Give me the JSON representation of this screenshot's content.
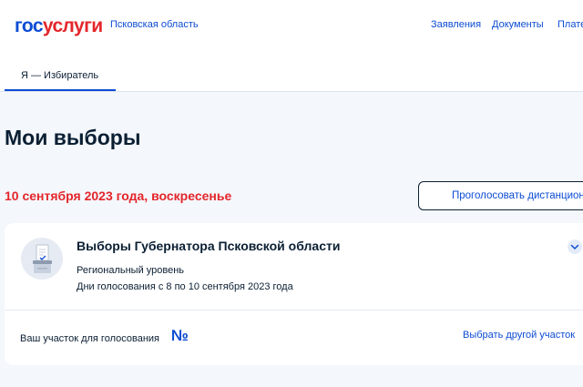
{
  "header": {
    "logo_part1": "гос",
    "logo_part2": "услуги",
    "region": "Псковская область",
    "nav": [
      "Заявления",
      "Документы",
      "Платежи"
    ]
  },
  "tabs": {
    "active": "Я — Избиратель"
  },
  "page": {
    "title": "Мои выборы",
    "date": "10 сентября 2023 года, воскресенье",
    "vote_button": "Проголосовать дистанционно"
  },
  "election": {
    "title": "Выборы Губернатора Псковской области",
    "level": "Региональный уровень",
    "days": "Дни голосования с 8 по 10 сентября 2023 года",
    "station_label": "Ваш участок для голосования",
    "station_number": "№",
    "change_link": "Выбрать другой участок"
  },
  "icons": {
    "ballot": "ballot-box-icon",
    "expand": "chevron-down-icon"
  },
  "colors": {
    "brand_blue": "#0d4cd3",
    "brand_red": "#e3262b",
    "text": "#0b1f33",
    "background": "#f4f7fc"
  }
}
